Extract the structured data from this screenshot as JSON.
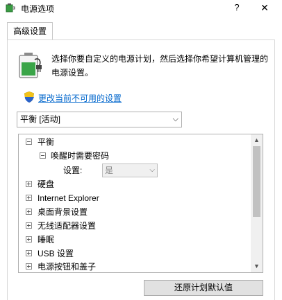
{
  "window": {
    "title": "电源选项",
    "help_glyph": "?",
    "close_glyph": "✕"
  },
  "tabs": [
    {
      "label": "高级设置"
    }
  ],
  "description": "选择你要自定义的电源计划，然后选择你希望计算机管理的电源设置。",
  "change_link": "更改当前不可用的设置",
  "plan_select": {
    "value": "平衡 [活动]"
  },
  "tree": {
    "items": [
      {
        "label": "平衡",
        "state": "expanded",
        "level": 0
      },
      {
        "label": "唤醒时需要密码",
        "state": "expanded",
        "level": 1
      },
      {
        "label": "设置:",
        "state": "leaf",
        "level": 2,
        "value": "是"
      },
      {
        "label": "硬盘",
        "state": "collapsed",
        "level": 0
      },
      {
        "label": "Internet Explorer",
        "state": "collapsed",
        "level": 0
      },
      {
        "label": "桌面背景设置",
        "state": "collapsed",
        "level": 0
      },
      {
        "label": "无线适配器设置",
        "state": "collapsed",
        "level": 0
      },
      {
        "label": "睡眠",
        "state": "collapsed",
        "level": 0
      },
      {
        "label": "USB 设置",
        "state": "collapsed",
        "level": 0
      },
      {
        "label": "电源按钮和盖子",
        "state": "collapsed",
        "level": 0
      }
    ]
  },
  "restore_button": {
    "label": "还原计划默认值"
  },
  "colors": {
    "link": "#0066cc",
    "battery_green": "#2e9b3a"
  },
  "icons": [
    "app-power-icon",
    "battery-plug-icon",
    "shield-icon",
    "chevron-down-icon"
  ]
}
